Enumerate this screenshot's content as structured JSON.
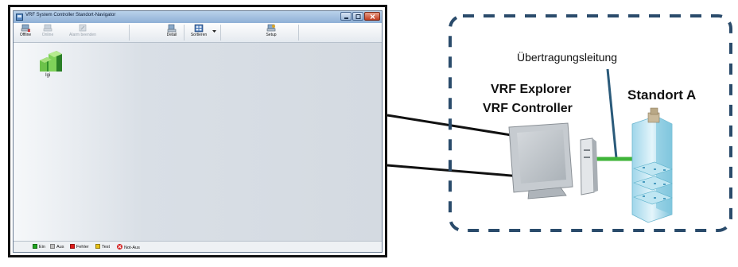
{
  "app_window": {
    "title": "VRF System Controller Standort-Navigator",
    "toolbar": [
      {
        "label": "Offline",
        "icon": "offline-icon",
        "enabled": true
      },
      {
        "label": "Online",
        "icon": "online-icon",
        "enabled": false
      },
      {
        "label": "Alarm beenden",
        "icon": "alarm-stop-icon",
        "enabled": false
      },
      {
        "label": "Detail",
        "icon": "detail-icon",
        "enabled": true
      },
      {
        "label": "Sortieren",
        "icon": "sort-icon",
        "enabled": true
      },
      {
        "label": "Setup",
        "icon": "setup-icon",
        "enabled": true
      }
    ],
    "site": {
      "label": "Igi",
      "icon": "building-site-icon"
    },
    "legend": [
      {
        "label": "Ein",
        "color": "#1fa51f"
      },
      {
        "label": "Aus",
        "color": "#bfbfbf"
      },
      {
        "label": "Fehler",
        "color": "#e01b1b"
      },
      {
        "label": "Test",
        "color": "#e8c21a"
      },
      {
        "label": "Not-Aus",
        "color": "#d21c1c"
      }
    ]
  },
  "diagram": {
    "transmission_line_label": "Übertragungsleitung",
    "computer_label_1": "VRF Explorer",
    "computer_label_2": "VRF Controller",
    "site_label": "Standort A",
    "colors": {
      "dashed_border": "#2a4b6b",
      "network_cable": "#3fb43a",
      "pointer_line": "#2a5a7a"
    }
  }
}
